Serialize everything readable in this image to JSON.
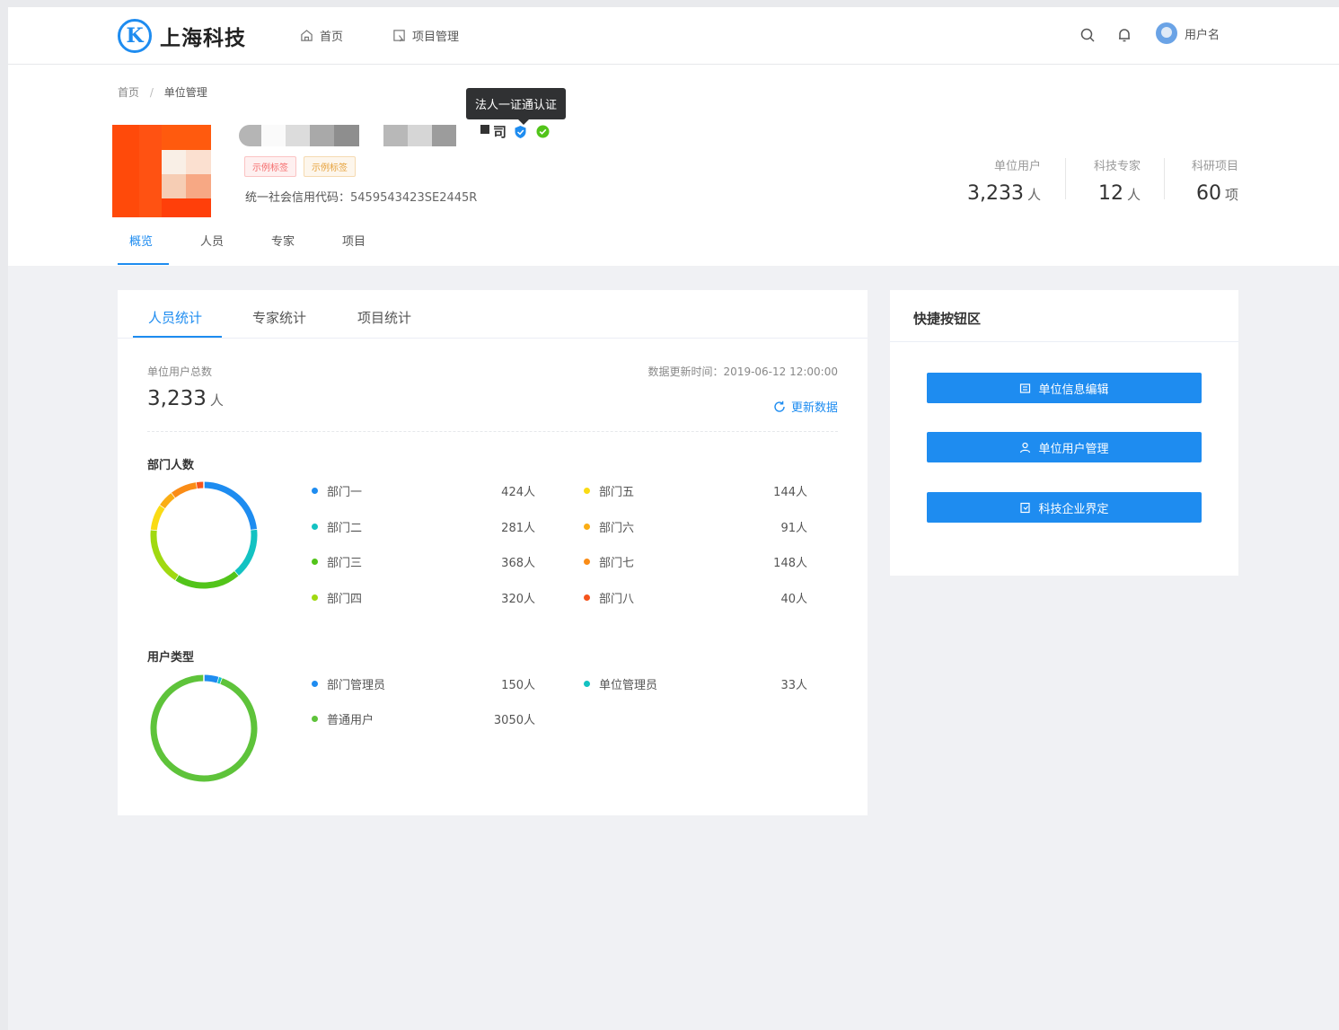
{
  "header": {
    "logo_letter": "K",
    "brand": "上海科技",
    "nav": [
      {
        "label": "首页",
        "icon": "home-icon"
      },
      {
        "label": "项目管理",
        "icon": "project-icon"
      }
    ],
    "username": "用户名"
  },
  "breadcrumb": {
    "home": "首页",
    "separator": "/",
    "current": "单位管理"
  },
  "company": {
    "name_tail": "司",
    "tooltip": "法人一证通认证",
    "tags": [
      "示例标签",
      "示例标签"
    ],
    "credit_label": "统一社会信用代码：",
    "credit_code": "5459543423SE2445R",
    "stats": [
      {
        "label": "单位用户",
        "value": "3,233",
        "unit": "人"
      },
      {
        "label": "科技专家",
        "value": "12",
        "unit": "人"
      },
      {
        "label": "科研项目",
        "value": "60",
        "unit": "项"
      }
    ],
    "subtabs": [
      "概览",
      "人员",
      "专家",
      "项目"
    ],
    "active_subtab": "概览"
  },
  "main": {
    "tabs": [
      "人员统计",
      "专家统计",
      "项目统计"
    ],
    "active_tab": "人员统计",
    "total_label": "单位用户总数",
    "total_value": "3,233",
    "total_unit": "人",
    "update_time": "数据更新时间：2019-06-12 12:00:00",
    "refresh_label": "更新数据",
    "dept_title": "部门人数",
    "type_title": "用户类型"
  },
  "chart_data": [
    {
      "type": "pie",
      "title": "部门人数",
      "categories": [
        "部门一",
        "部门二",
        "部门三",
        "部门四",
        "部门五",
        "部门六",
        "部门七",
        "部门八"
      ],
      "values": [
        424,
        281,
        368,
        320,
        144,
        91,
        148,
        40
      ],
      "value_labels": [
        "424人",
        "281人",
        "368人",
        "320人",
        "144人",
        "91人",
        "148人",
        "40人"
      ],
      "colors": [
        "#1e8cf0",
        "#13c2c2",
        "#52c41a",
        "#a0d911",
        "#fadb14",
        "#faad14",
        "#fa8c16",
        "#f5541c"
      ]
    },
    {
      "type": "pie",
      "title": "用户类型",
      "categories": [
        "部门管理员",
        "单位管理员",
        "普通用户"
      ],
      "values": [
        150,
        33,
        3050
      ],
      "value_labels": [
        "150人",
        "33人",
        "3050人"
      ],
      "colors": [
        "#1e8cf0",
        "#13c2c2",
        "#5ec33a"
      ]
    }
  ],
  "side": {
    "title": "快捷按钮区",
    "buttons": [
      {
        "label": "单位信息编辑",
        "icon": "edit-info-icon"
      },
      {
        "label": "单位用户管理",
        "icon": "users-icon"
      },
      {
        "label": "科技企业界定",
        "icon": "document-icon"
      }
    ]
  }
}
